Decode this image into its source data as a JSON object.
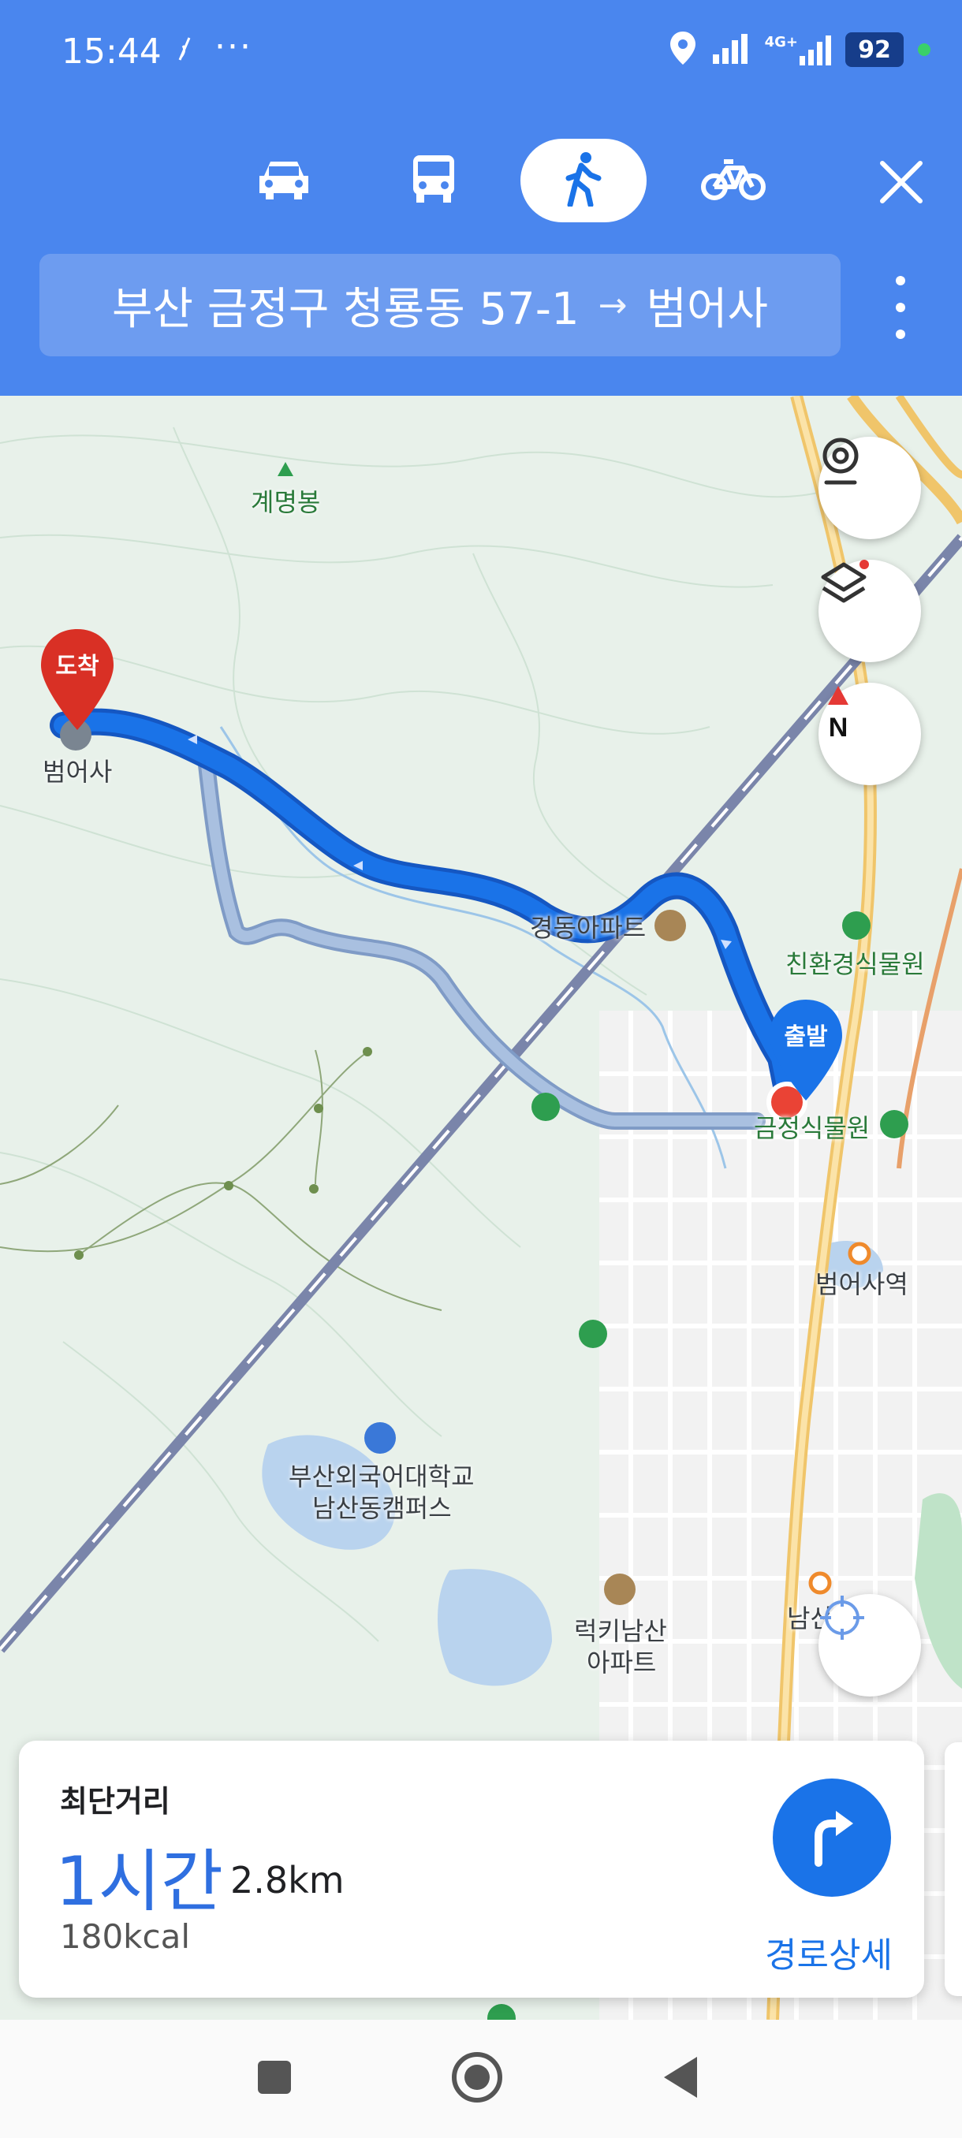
{
  "status_bar": {
    "time": "15:44",
    "extra_icon": "nfc-icon",
    "dots": "···",
    "network": "4G+",
    "battery": "92"
  },
  "modes": [
    {
      "name": "car",
      "icon": "car-icon",
      "active": false
    },
    {
      "name": "transit",
      "icon": "bus-icon",
      "active": false
    },
    {
      "name": "walk",
      "icon": "walk-icon",
      "active": true
    },
    {
      "name": "bike",
      "icon": "bike-icon",
      "active": false
    }
  ],
  "route": {
    "origin": "부산 금정구 청룡동 57-1",
    "arrow": "→",
    "destination": "범어사"
  },
  "map": {
    "labels": {
      "peak": "계명봉",
      "temple": "범어사",
      "apartment1": "경동아파트",
      "arboretum_label": "친환경식물원",
      "start_area": "금정식물원",
      "station": "범어사역",
      "univ_line1": "부산외국어대학교",
      "univ_line2": "남산동캠퍼스",
      "apartment2_line1": "럭키남산",
      "apartment2_line2": "아파트",
      "station2": "남산"
    },
    "pins": {
      "arrival": "도착",
      "departure": "출발"
    },
    "colors": {
      "route_primary": "#1a73e8",
      "route_alt": "#9ab3d4",
      "arrival_pin": "#d93025",
      "departure_pin": "#1a73e8"
    }
  },
  "card": {
    "title": "최단거리",
    "duration": "1시간",
    "distance": "2.8km",
    "calories": "180kcal",
    "details_label": "경로상세"
  }
}
